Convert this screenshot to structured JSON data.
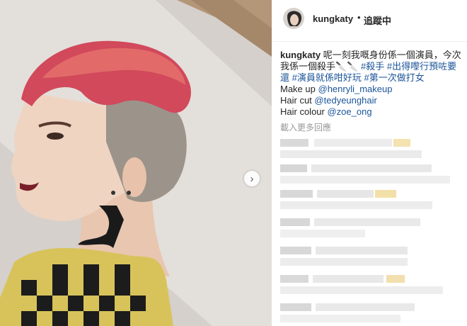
{
  "post": {
    "username": "kungkaty",
    "header_separator": "•",
    "follow_label": "追蹤中",
    "caption": {
      "username": "kungkaty",
      "text_line1": "呢一刻我嘅身份係一個演員，今次",
      "text_line2": "我係一個殺手",
      "line2_icons": "🔪🔪",
      "hashtag1": "#殺手",
      "hashtag2": "#出得嚟行預咗要",
      "hashtag2_cont": "還",
      "hashtag3": "#演員就係咁好玩",
      "hashtag4": "#第一次做打女",
      "makeup_prefix": "Make up",
      "makeup_handle": "@henryli_makeup",
      "haircut_prefix": "Hair cut",
      "haircut_handle": "@tedyeunghair",
      "haircolour_prefix": "Hair colour",
      "haircolour_handle": "@zoe_ong"
    },
    "load_more_label": "載入更多回應",
    "next_arrow": "›",
    "colors": {
      "link": "#1b5499",
      "text": "#262626",
      "muted": "#999999",
      "hair": "#d1495b",
      "tattoo": "#1a1a1a"
    },
    "icons": {
      "knife": "knife-icon",
      "next": "chevron-right-icon"
    }
  }
}
